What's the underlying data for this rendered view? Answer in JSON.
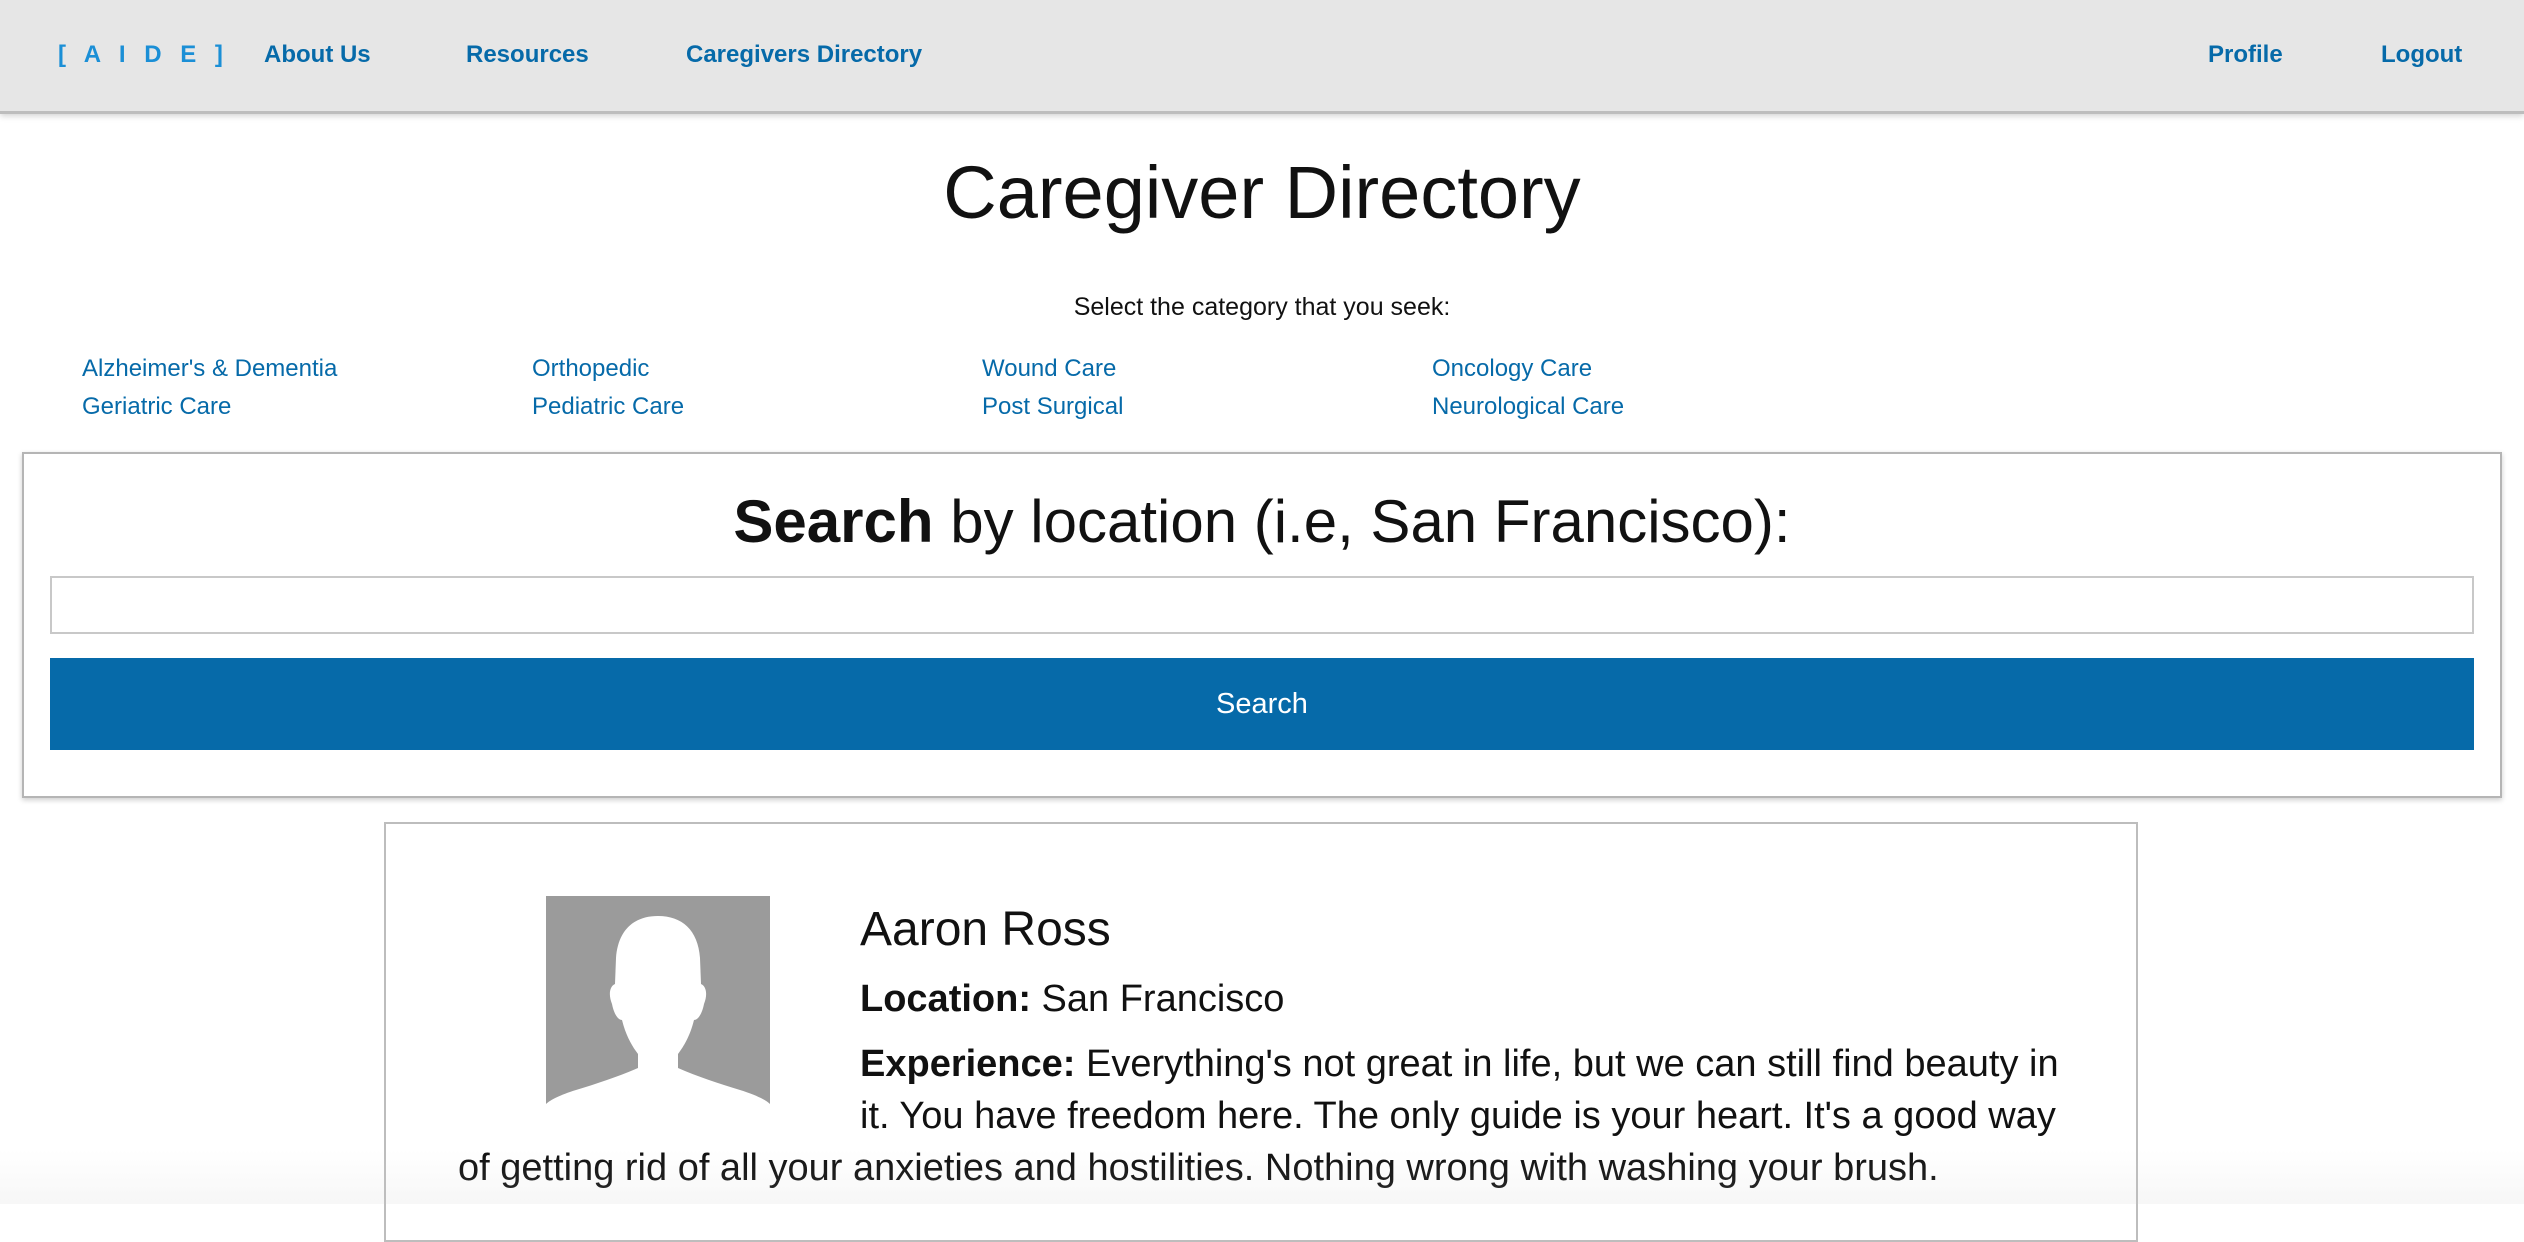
{
  "nav": {
    "logo": "[ A I D E ]",
    "about": "About Us",
    "resources": "Resources",
    "directory": "Caregivers Directory",
    "profile": "Profile",
    "logout": "Logout"
  },
  "page": {
    "title": "Caregiver Directory",
    "category_prompt": "Select the category that you seek:"
  },
  "categories": [
    "Alzheimer's & Dementia",
    "Orthopedic",
    "Wound Care",
    "Oncology Care",
    "Geriatric Care",
    "Pediatric Care",
    "Post Surgical",
    "Neurological Care"
  ],
  "search": {
    "heading_bold": "Search",
    "heading_rest": " by location (i.e, San Francisco):",
    "input_value": "",
    "button_label": "Search"
  },
  "caregiver": {
    "name": "Aaron Ross",
    "location_label": "Location:",
    "location": " San Francisco",
    "experience_label": "Experience:",
    "experience_line1": " Everything's not great in life, but we can still find beauty in",
    "experience_line2": "it. You have freedom here. The only guide is your heart. It's a good way",
    "experience_line3": "of getting rid of all your anxieties and hostilities. Nothing wrong with washing your brush."
  },
  "colors": {
    "link": "#066aa9",
    "logo": "#1b8fd6",
    "button": "#066aa9",
    "navbar_bg": "#e6e6e6",
    "avatar_bg": "#9b9b9b"
  },
  "icons": {
    "avatar": "default-person-silhouette-icon"
  }
}
